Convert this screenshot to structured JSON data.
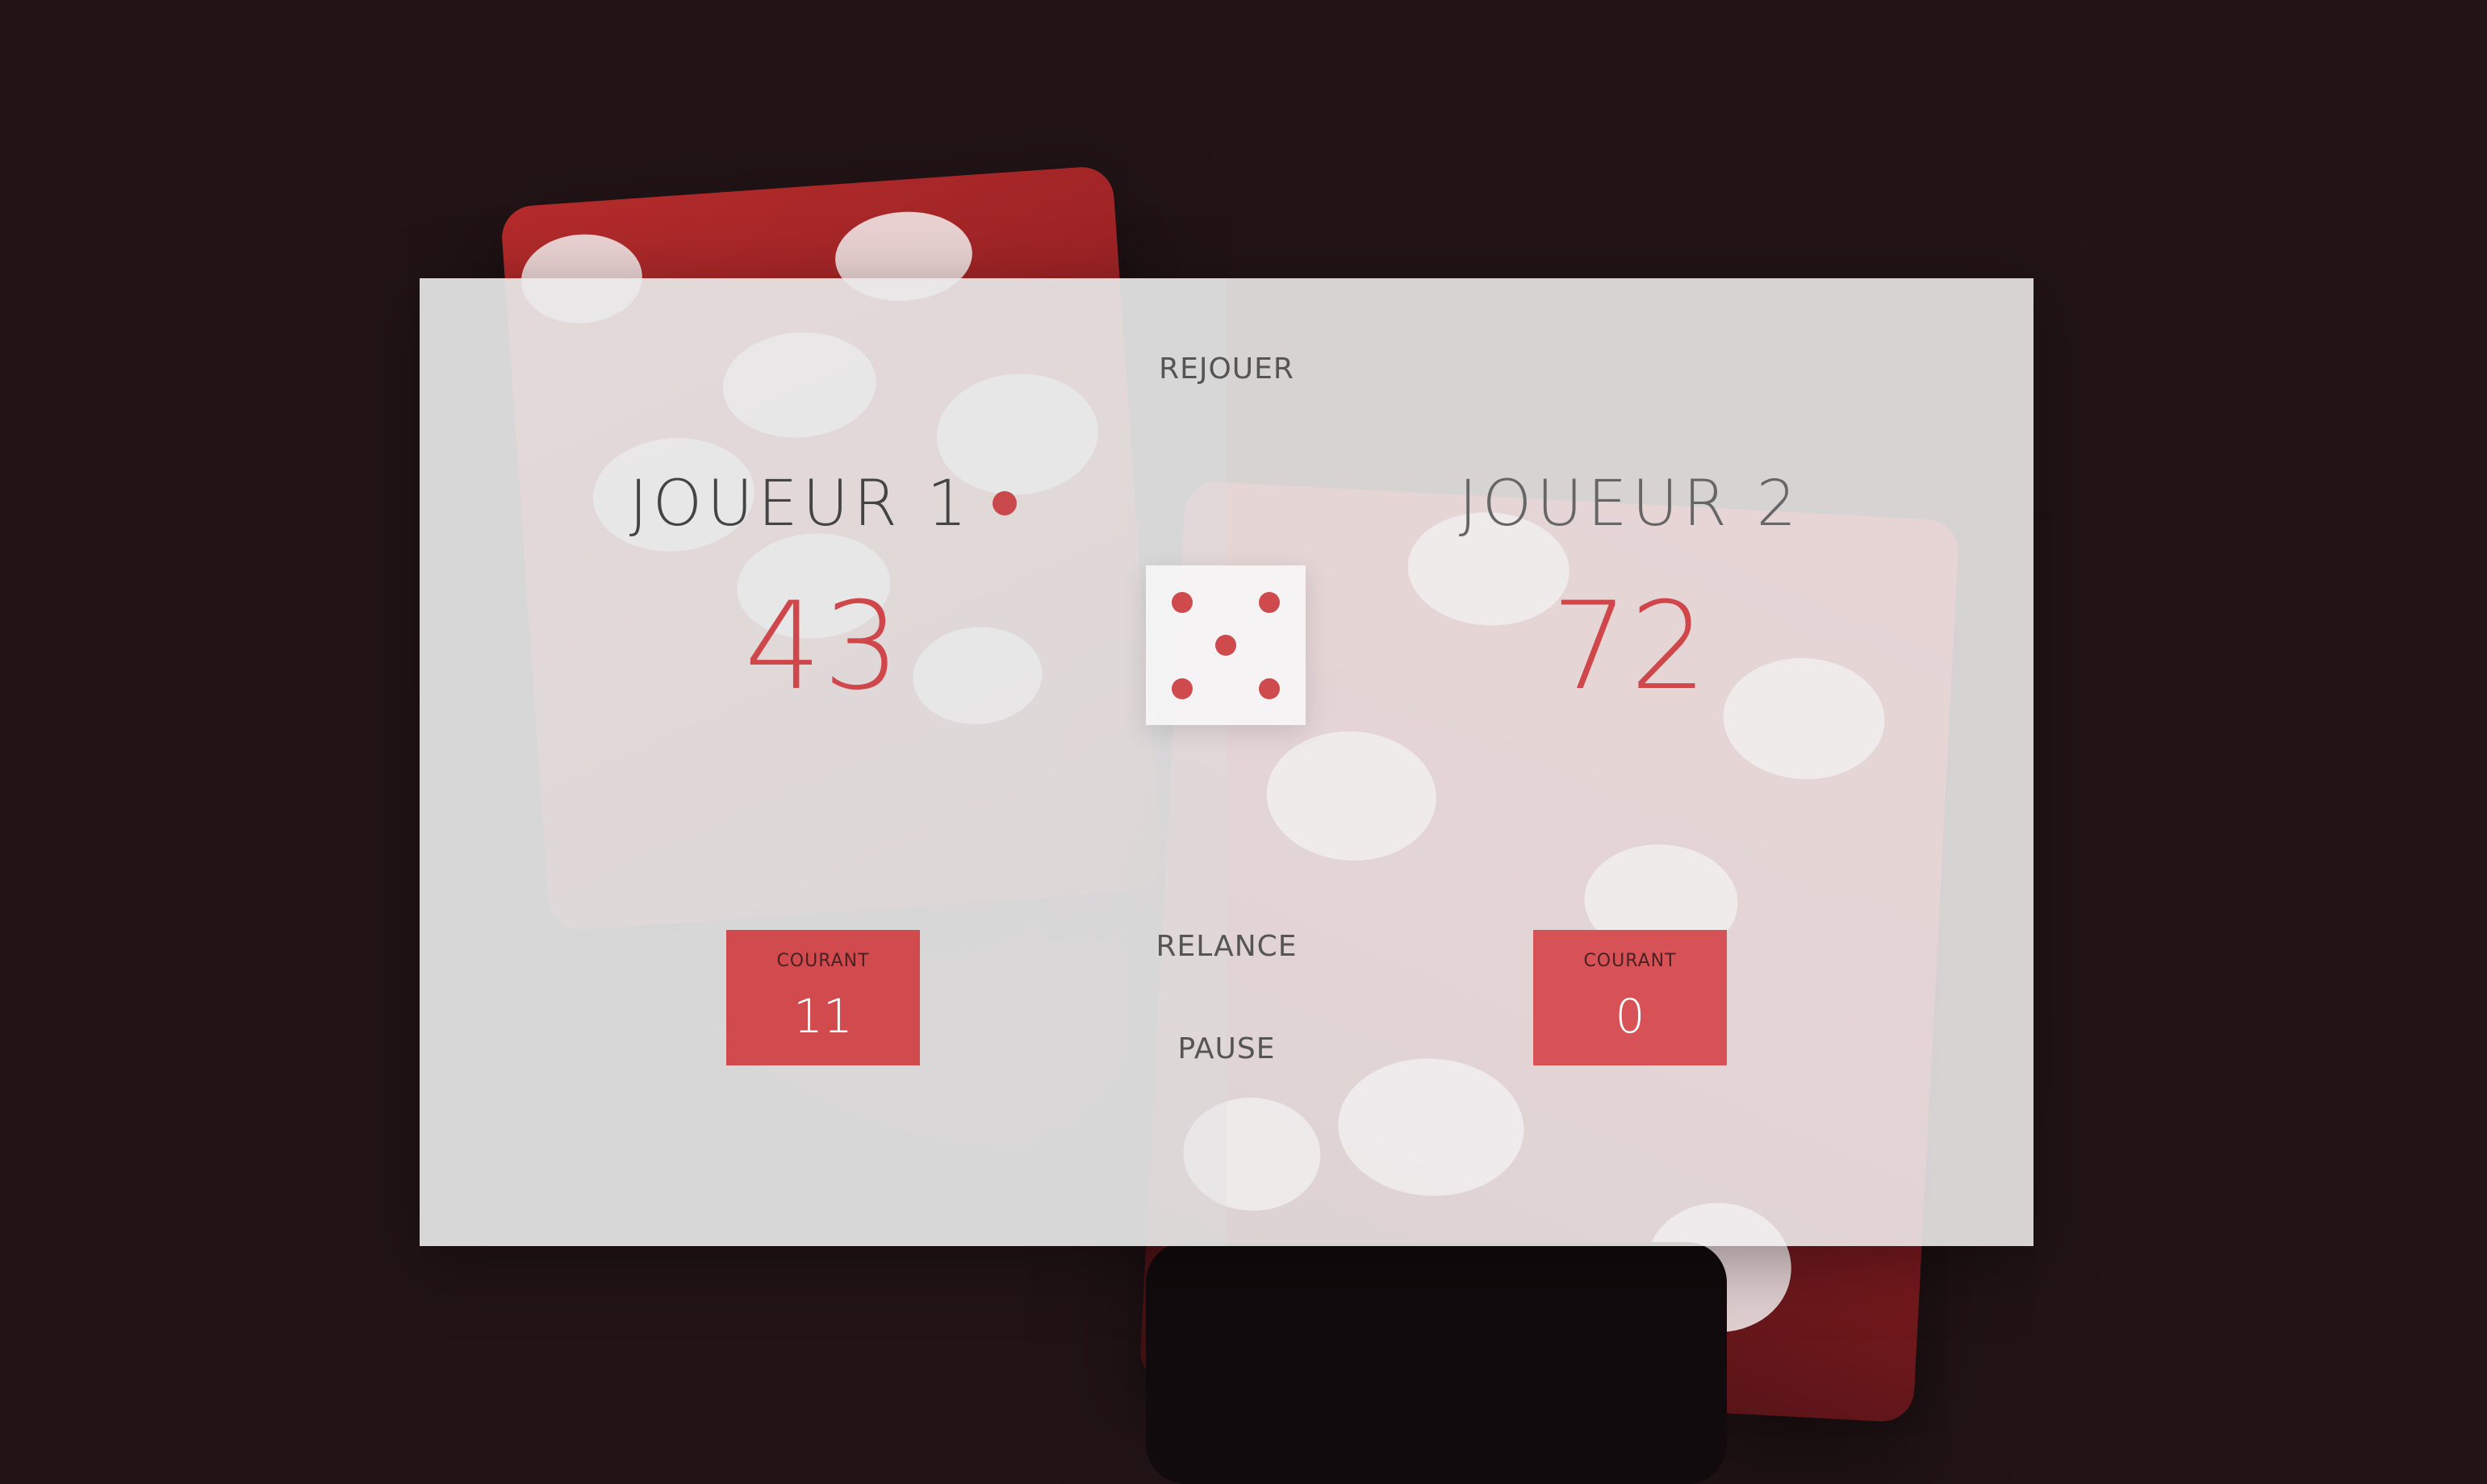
{
  "controls": {
    "new_game": "REJOUER",
    "roll": "RELANCE",
    "hold": "PAUSE"
  },
  "players": [
    {
      "name": "JOUEUR 1",
      "score": "43",
      "current_label": "COURANT",
      "current_score": "11",
      "active": true
    },
    {
      "name": "JOUEUR 2",
      "score": "72",
      "current_label": "COURANT",
      "current_score": "0",
      "active": false
    }
  ],
  "dice": {
    "value": 5
  },
  "colors": {
    "accent": "#d0474b",
    "background": "#221416",
    "panel": "#e8e8e8"
  }
}
